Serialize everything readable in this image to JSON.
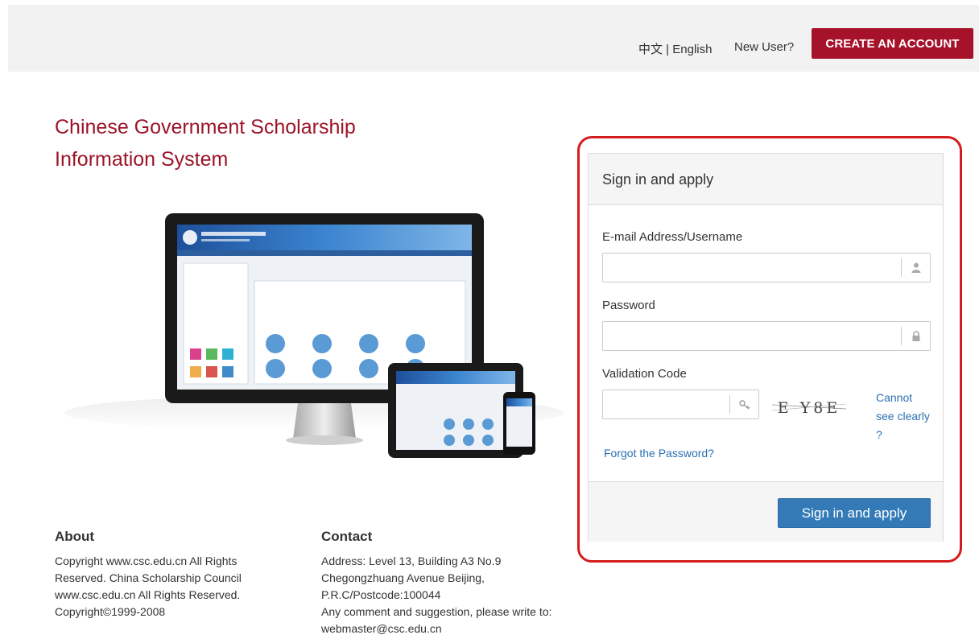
{
  "header": {
    "lang_cn": "中文",
    "lang_sep": " | ",
    "lang_en": "English",
    "new_user": "New User?",
    "create_account": "CREATE AN ACCOUNT"
  },
  "site": {
    "title_line1": "Chinese Government Scholarship",
    "title_line2": "Information System"
  },
  "login": {
    "heading": "Sign in and apply",
    "email_label": "E-mail Address/Username",
    "email_value": "",
    "password_label": "Password",
    "password_value": "",
    "code_label": "Validation Code",
    "code_value": "",
    "captcha_text": "E Y8E",
    "cannot_see": "Cannot see clearly ?",
    "forgot": "Forgot the Password?",
    "submit": "Sign in and apply"
  },
  "footer": {
    "about_title": "About",
    "about_text": "Copyright www.csc.edu.cn All Rights Reserved. China Scholarship Council www.csc.edu.cn All Rights Reserved. Copyright©1999-2008",
    "contact_title": "Contact",
    "contact_address": "Address: Level 13, Building A3 No.9 Chegongzhuang Avenue Beijing, P.R.C/Postcode:100044",
    "contact_suggestion": "Any comment and suggestion, please write to: webmaster@csc.edu.cn"
  },
  "colors": {
    "brand_red": "#a6122a",
    "highlight_red": "#d51c1c",
    "primary_blue": "#337ab7",
    "link_blue": "#2a6fb1"
  },
  "icons": {
    "email_addon": "user-icon",
    "password_addon": "lock-icon",
    "code_addon": "key-icon"
  }
}
